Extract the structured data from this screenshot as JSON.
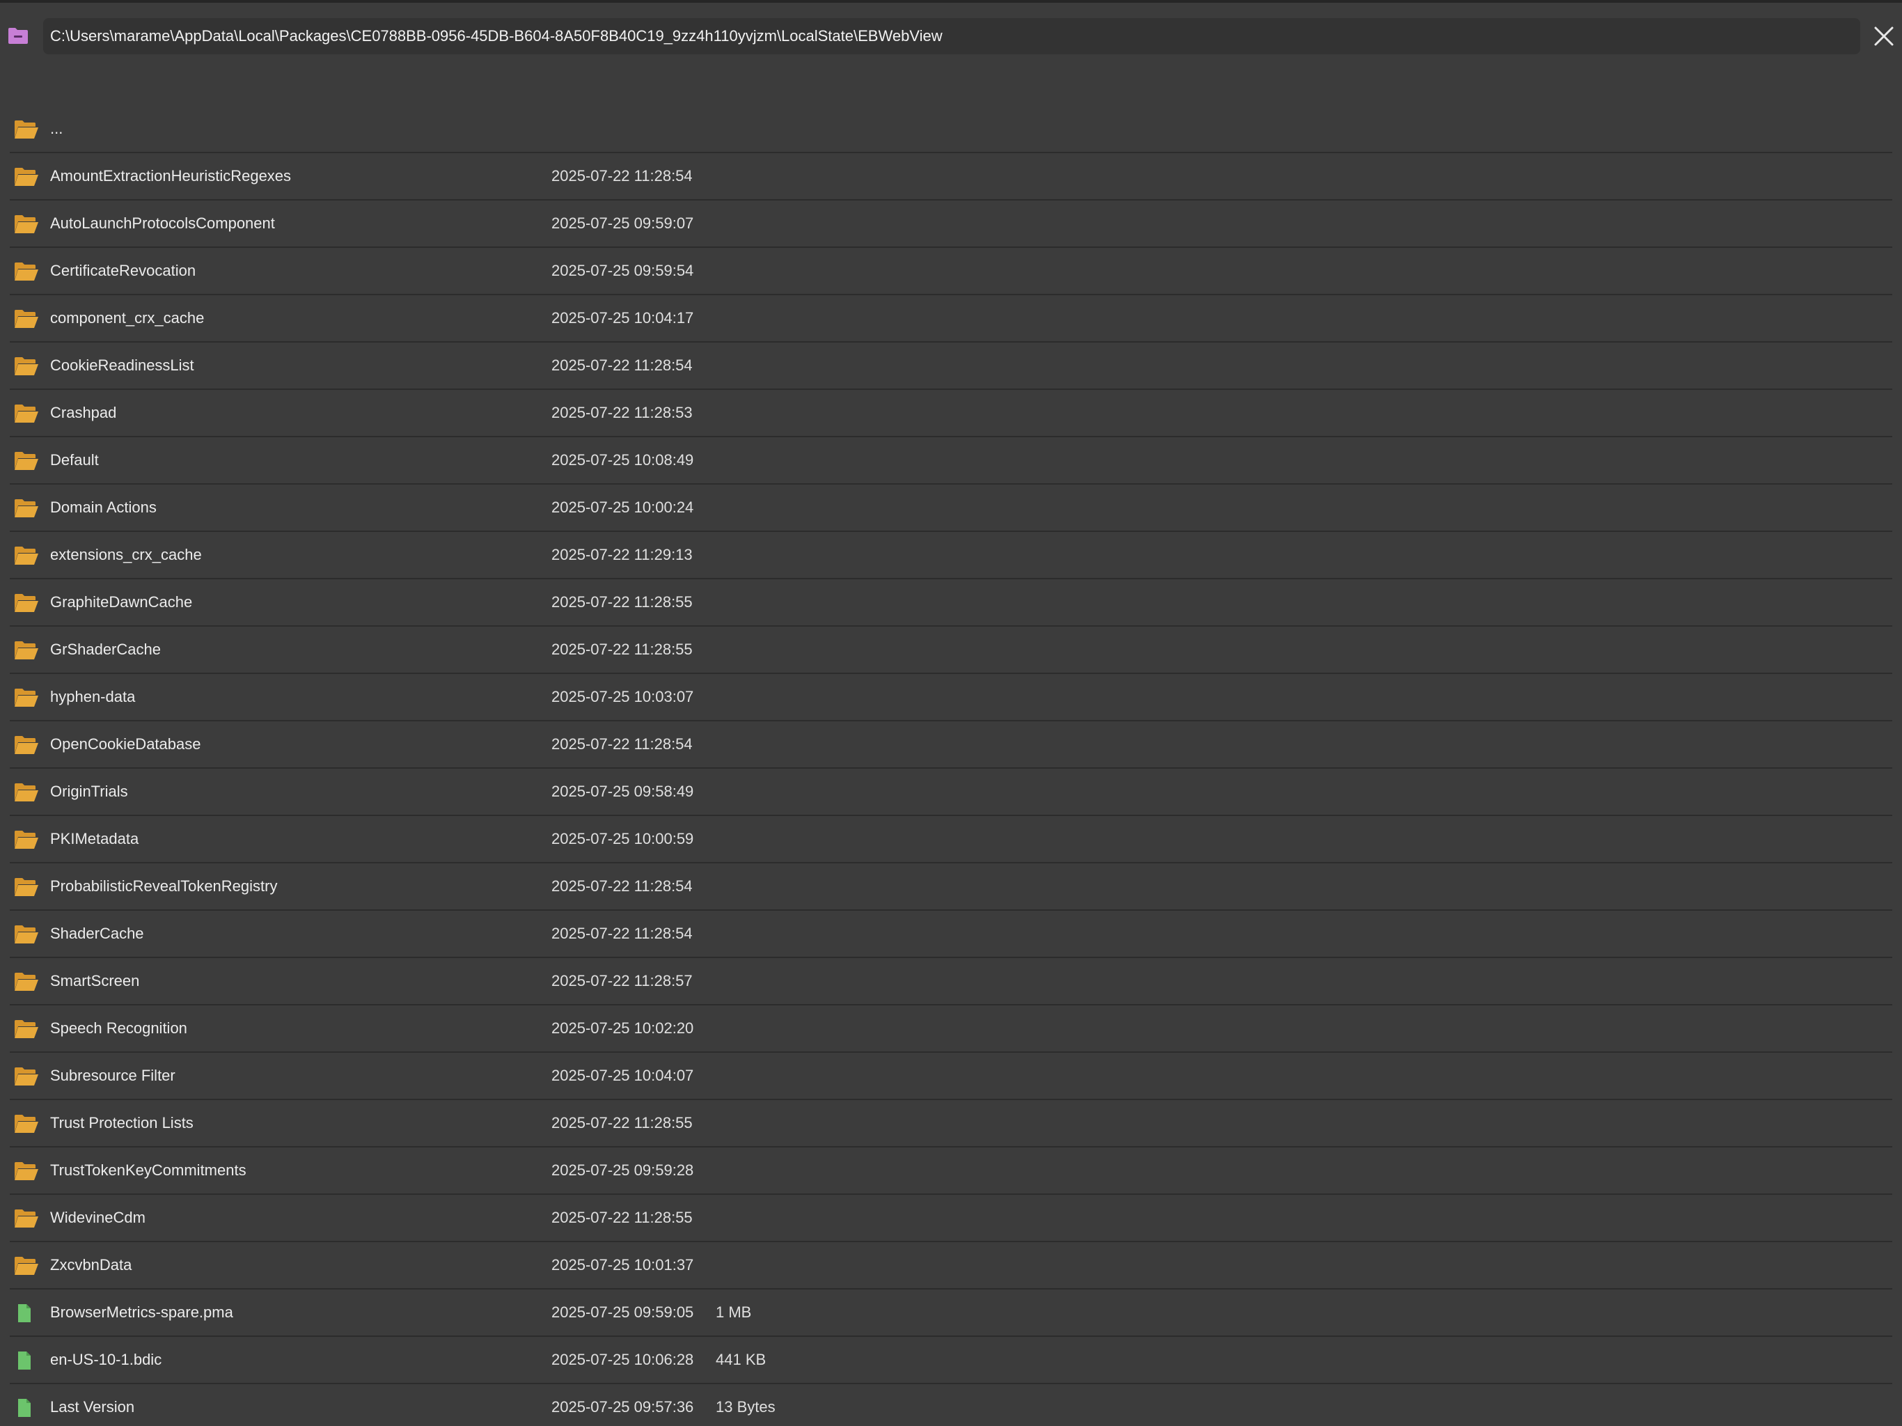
{
  "header": {
    "path": "C:\\Users\\marame\\AppData\\Local\\Packages\\CE0788BB-0956-45DB-B604-8A50F8B40C19_9zz4h110yvjzm\\LocalState\\EBWebView",
    "drive_icon": "drive-icon",
    "close_icon": "close-icon"
  },
  "colors": {
    "folder": "#e8a93a",
    "file": "#6cc46c",
    "drive": "#c77fd6",
    "background": "#3c3c3c",
    "path_box": "#333333"
  },
  "entries": [
    {
      "name": "...",
      "date": "",
      "size": "",
      "kind": "folder"
    },
    {
      "name": "AmountExtractionHeuristicRegexes",
      "date": "2025-07-22 11:28:54",
      "size": "",
      "kind": "folder"
    },
    {
      "name": "AutoLaunchProtocolsComponent",
      "date": "2025-07-25 09:59:07",
      "size": "",
      "kind": "folder"
    },
    {
      "name": "CertificateRevocation",
      "date": "2025-07-25 09:59:54",
      "size": "",
      "kind": "folder"
    },
    {
      "name": "component_crx_cache",
      "date": "2025-07-25 10:04:17",
      "size": "",
      "kind": "folder"
    },
    {
      "name": "CookieReadinessList",
      "date": "2025-07-22 11:28:54",
      "size": "",
      "kind": "folder"
    },
    {
      "name": "Crashpad",
      "date": "2025-07-22 11:28:53",
      "size": "",
      "kind": "folder"
    },
    {
      "name": "Default",
      "date": "2025-07-25 10:08:49",
      "size": "",
      "kind": "folder"
    },
    {
      "name": "Domain Actions",
      "date": "2025-07-25 10:00:24",
      "size": "",
      "kind": "folder"
    },
    {
      "name": "extensions_crx_cache",
      "date": "2025-07-22 11:29:13",
      "size": "",
      "kind": "folder"
    },
    {
      "name": "GraphiteDawnCache",
      "date": "2025-07-22 11:28:55",
      "size": "",
      "kind": "folder"
    },
    {
      "name": "GrShaderCache",
      "date": "2025-07-22 11:28:55",
      "size": "",
      "kind": "folder"
    },
    {
      "name": "hyphen-data",
      "date": "2025-07-25 10:03:07",
      "size": "",
      "kind": "folder"
    },
    {
      "name": "OpenCookieDatabase",
      "date": "2025-07-22 11:28:54",
      "size": "",
      "kind": "folder"
    },
    {
      "name": "OriginTrials",
      "date": "2025-07-25 09:58:49",
      "size": "",
      "kind": "folder"
    },
    {
      "name": "PKIMetadata",
      "date": "2025-07-25 10:00:59",
      "size": "",
      "kind": "folder"
    },
    {
      "name": "ProbabilisticRevealTokenRegistry",
      "date": "2025-07-22 11:28:54",
      "size": "",
      "kind": "folder"
    },
    {
      "name": "ShaderCache",
      "date": "2025-07-22 11:28:54",
      "size": "",
      "kind": "folder"
    },
    {
      "name": "SmartScreen",
      "date": "2025-07-22 11:28:57",
      "size": "",
      "kind": "folder"
    },
    {
      "name": "Speech Recognition",
      "date": "2025-07-25 10:02:20",
      "size": "",
      "kind": "folder"
    },
    {
      "name": "Subresource Filter",
      "date": "2025-07-25 10:04:07",
      "size": "",
      "kind": "folder"
    },
    {
      "name": "Trust Protection Lists",
      "date": "2025-07-22 11:28:55",
      "size": "",
      "kind": "folder"
    },
    {
      "name": "TrustTokenKeyCommitments",
      "date": "2025-07-25 09:59:28",
      "size": "",
      "kind": "folder"
    },
    {
      "name": "WidevineCdm",
      "date": "2025-07-22 11:28:55",
      "size": "",
      "kind": "folder"
    },
    {
      "name": "ZxcvbnData",
      "date": "2025-07-25 10:01:37",
      "size": "",
      "kind": "folder"
    },
    {
      "name": "BrowserMetrics-spare.pma",
      "date": "2025-07-25 09:59:05",
      "size": "1 MB",
      "kind": "file"
    },
    {
      "name": "en-US-10-1.bdic",
      "date": "2025-07-25 10:06:28",
      "size": "441 KB",
      "kind": "file"
    },
    {
      "name": "Last Version",
      "date": "2025-07-25 09:57:36",
      "size": "13 Bytes",
      "kind": "file"
    }
  ]
}
